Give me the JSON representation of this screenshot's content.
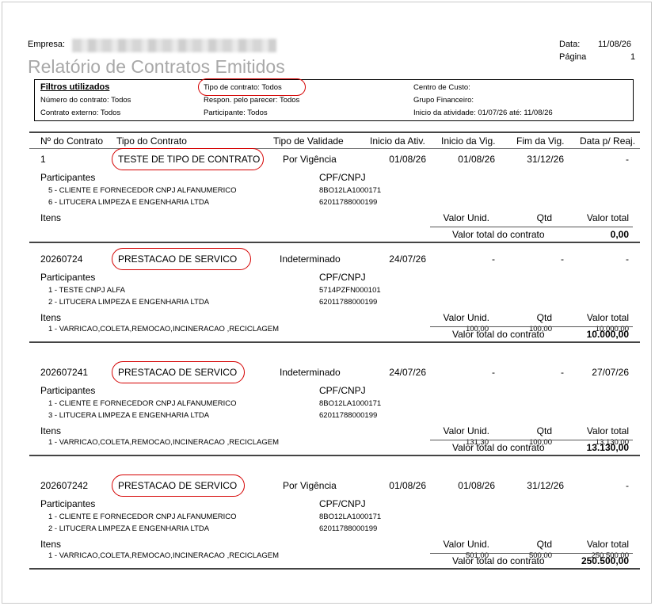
{
  "header": {
    "empresa_label": "Empresa:",
    "data_label": "Data:",
    "data_value": "11/08/26",
    "pagina_label": "Página",
    "pagina_value": "1",
    "report_title": "Relatório de Contratos Emitidos"
  },
  "filters": {
    "title": "Filtros utilizados",
    "numero_contrato": "Número do contrato: Todos",
    "contrato_externo": "Contrato externo: Todos",
    "tipo_contrato": "Tipo de contrato: Todos",
    "respon": "Respon. pelo parecer: Todos",
    "participante": "Participante: Todos",
    "centro_custo": "Centro de Custo:",
    "grupo_financeiro": "Grupo Financeiro:",
    "inicio_atividade": "Inicio da atividade: 01/07/26 até: 11/08/26"
  },
  "columns": {
    "numero": "Nº do Contrato",
    "tipo": "Tipo do Contrato",
    "validade": "Tipo de Validade",
    "inicio_ativ": "Inicio da Ativ.",
    "inicio_vig": "Inicio da Vig.",
    "fim_vig": "Fim da Vig.",
    "data_reaj": "Data p/ Reaj."
  },
  "labels": {
    "participantes": "Participantes",
    "cpf_cnpj": "CPF/CNPJ",
    "itens": "Itens",
    "valor_unid": "Valor Unid.",
    "qtd": "Qtd",
    "valor_total": "Valor total",
    "valor_total_contrato": "Valor total do contrato"
  },
  "contracts": [
    {
      "numero": "1",
      "tipo": "TESTE DE TIPO DE CONTRATO",
      "validade": "Por Vigência",
      "inicio_ativ": "01/08/26",
      "inicio_vig": "01/08/26",
      "fim_vig": "31/12/26",
      "data_reaj": "-",
      "participants": [
        {
          "name": "5 - CLIENTE E FORNECEDOR CNPJ ALFANUMERICO",
          "doc": "8BO12LA1000171"
        },
        {
          "name": "6 - LITUCERA LIMPEZA E ENGENHARIA LTDA",
          "doc": "62011788000199"
        }
      ],
      "items": [],
      "total": "0,00"
    },
    {
      "numero": "20260724",
      "tipo": "PRESTACAO DE SERVICO",
      "validade": "Indeterminado",
      "inicio_ativ": "24/07/26",
      "inicio_vig": "-",
      "fim_vig": "-",
      "data_reaj": "-",
      "participants": [
        {
          "name": "1 - TESTE CNPJ ALFA",
          "doc": "5714PZFN000101"
        },
        {
          "name": "2 - LITUCERA LIMPEZA E ENGENHARIA LTDA",
          "doc": "62011788000199"
        }
      ],
      "items": [
        {
          "desc": "1 - VARRICAO,COLETA,REMOCAO,INCINERACAO ,RECICLAGEM",
          "unit": "100,00",
          "qtd": "100,00",
          "total": "10.000,00"
        }
      ],
      "total": "10.000,00"
    },
    {
      "numero": "202607241",
      "tipo": "PRESTACAO DE SERVICO",
      "validade": "Indeterminado",
      "inicio_ativ": "24/07/26",
      "inicio_vig": "-",
      "fim_vig": "-",
      "data_reaj": "27/07/26",
      "participants": [
        {
          "name": "1 - CLIENTE E FORNECEDOR CNPJ ALFANUMERICO",
          "doc": "8BO12LA1000171"
        },
        {
          "name": "3 - LITUCERA LIMPEZA E ENGENHARIA LTDA",
          "doc": "62011788000199"
        }
      ],
      "items": [
        {
          "desc": "1 - VARRICAO,COLETA,REMOCAO,INCINERACAO ,RECICLAGEM",
          "unit": "131,30",
          "qtd": "100,00",
          "total": "13.130,00"
        }
      ],
      "total": "13.130,00"
    },
    {
      "numero": "202607242",
      "tipo": "PRESTACAO DE SERVICO",
      "validade": "Por Vigência",
      "inicio_ativ": "01/08/26",
      "inicio_vig": "01/08/26",
      "fim_vig": "31/12/26",
      "data_reaj": "-",
      "participants": [
        {
          "name": "1 - CLIENTE E FORNECEDOR CNPJ ALFANUMERICO",
          "doc": "8BO12LA1000171"
        },
        {
          "name": "2 - LITUCERA LIMPEZA E ENGENHARIA LTDA",
          "doc": "62011788000199"
        }
      ],
      "items": [
        {
          "desc": "1 - VARRICAO,COLETA,REMOCAO,INCINERACAO ,RECICLAGEM",
          "unit": "501,00",
          "qtd": "500,00",
          "total": "250.500,00"
        }
      ],
      "total": "250.500,00"
    }
  ]
}
